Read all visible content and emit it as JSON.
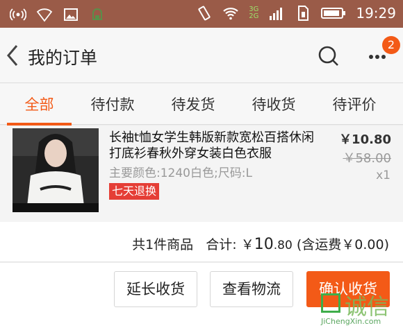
{
  "status_bar": {
    "time": "19:29",
    "network_3g": "3G",
    "network_2g": "2G",
    "icons": [
      "broadcast-icon",
      "wifi-icon",
      "image-icon",
      "android-icon",
      "vibrate-icon",
      "wifi-icon",
      "signal-icon",
      "sim-icon",
      "battery-icon"
    ]
  },
  "header": {
    "title": "我的订单",
    "badge_count": "2"
  },
  "tabs": [
    {
      "label": "全部",
      "active": true
    },
    {
      "label": "待付款",
      "active": false
    },
    {
      "label": "待发货",
      "active": false
    },
    {
      "label": "待收货",
      "active": false
    },
    {
      "label": "待评价",
      "active": false
    }
  ],
  "product": {
    "title": "长袖t恤女学生韩版新款宽松百搭休闲打底衫春秋外穿女装白色衣服",
    "specs": "主要颜色:1240白色;尺码:L",
    "return_badge": "七天退换",
    "price_current": "￥10.80",
    "price_original": "￥58.00",
    "quantity": "x1"
  },
  "summary": {
    "count_text": "共1件商品",
    "total_label": "合计:",
    "total_currency": "￥",
    "total_integer": "10",
    "total_cents": ".80",
    "shipping_text": "(含运费￥0.00)"
  },
  "actions": {
    "extend_label": "延长收货",
    "logistics_label": "查看物流",
    "confirm_label": "确认收货"
  },
  "watermark": {
    "text": "诚信",
    "url": "JiChengXin.com"
  },
  "colors": {
    "accent": "#f35a17",
    "status_bar": "#9a5b48",
    "return_badge": "#e53e36"
  }
}
